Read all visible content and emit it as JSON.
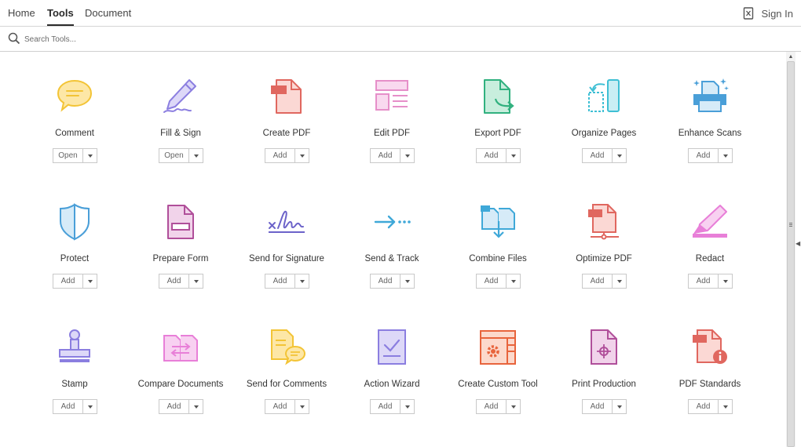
{
  "tabs": [
    {
      "label": "Home",
      "active": false
    },
    {
      "label": "Tools",
      "active": true
    },
    {
      "label": "Document",
      "active": false
    }
  ],
  "header": {
    "signin_label": "Sign In",
    "signin_icon": "device-icon"
  },
  "search": {
    "placeholder": "Search Tools..."
  },
  "tools": [
    {
      "label": "Comment",
      "button": "Open",
      "icon": "comment-icon",
      "color": "#f5c518"
    },
    {
      "label": "Fill & Sign",
      "button": "Open",
      "icon": "fill-sign-icon",
      "color": "#8b7ee0"
    },
    {
      "label": "Create PDF",
      "button": "Add",
      "icon": "create-pdf-icon",
      "color": "#e0675f"
    },
    {
      "label": "Edit PDF",
      "button": "Add",
      "icon": "edit-pdf-icon",
      "color": "#e68fc9"
    },
    {
      "label": "Export PDF",
      "button": "Add",
      "icon": "export-pdf-icon",
      "color": "#31b17f"
    },
    {
      "label": "Organize Pages",
      "button": "Add",
      "icon": "organize-pages-icon",
      "color": "#3ebfd4"
    },
    {
      "label": "Enhance Scans",
      "button": "Add",
      "icon": "enhance-scans-icon",
      "color": "#4a9fd8"
    },
    {
      "label": "Protect",
      "button": "Add",
      "icon": "shield-icon",
      "color": "#4a9fd8"
    },
    {
      "label": "Prepare Form",
      "button": "Add",
      "icon": "prepare-form-icon",
      "color": "#b04f9a"
    },
    {
      "label": "Send for Signature",
      "button": "Add",
      "icon": "signature-icon",
      "color": "#6c63c9"
    },
    {
      "label": "Send & Track",
      "button": "Add",
      "icon": "send-track-icon",
      "color": "#3fa8d8"
    },
    {
      "label": "Combine Files",
      "button": "Add",
      "icon": "combine-files-icon",
      "color": "#3fa8d8"
    },
    {
      "label": "Optimize PDF",
      "button": "Add",
      "icon": "optimize-pdf-icon",
      "color": "#e0675f"
    },
    {
      "label": "Redact",
      "button": "Add",
      "icon": "redact-icon",
      "color": "#e87fd8"
    },
    {
      "label": "Stamp",
      "button": "Add",
      "icon": "stamp-icon",
      "color": "#8b7ee0"
    },
    {
      "label": "Compare Documents",
      "button": "Add",
      "icon": "compare-documents-icon",
      "color": "#e87fd8"
    },
    {
      "label": "Send for Comments",
      "button": "Add",
      "icon": "send-comments-icon",
      "color": "#f5c518"
    },
    {
      "label": "Action Wizard",
      "button": "Add",
      "icon": "action-wizard-icon",
      "color": "#8b7ee0"
    },
    {
      "label": "Create Custom Tool",
      "button": "Add",
      "icon": "custom-tool-icon",
      "color": "#e8643c"
    },
    {
      "label": "Print Production",
      "button": "Add",
      "icon": "print-production-icon",
      "color": "#b04f9a"
    },
    {
      "label": "PDF Standards",
      "button": "Add",
      "icon": "pdf-standards-icon",
      "color": "#e0675f"
    }
  ]
}
